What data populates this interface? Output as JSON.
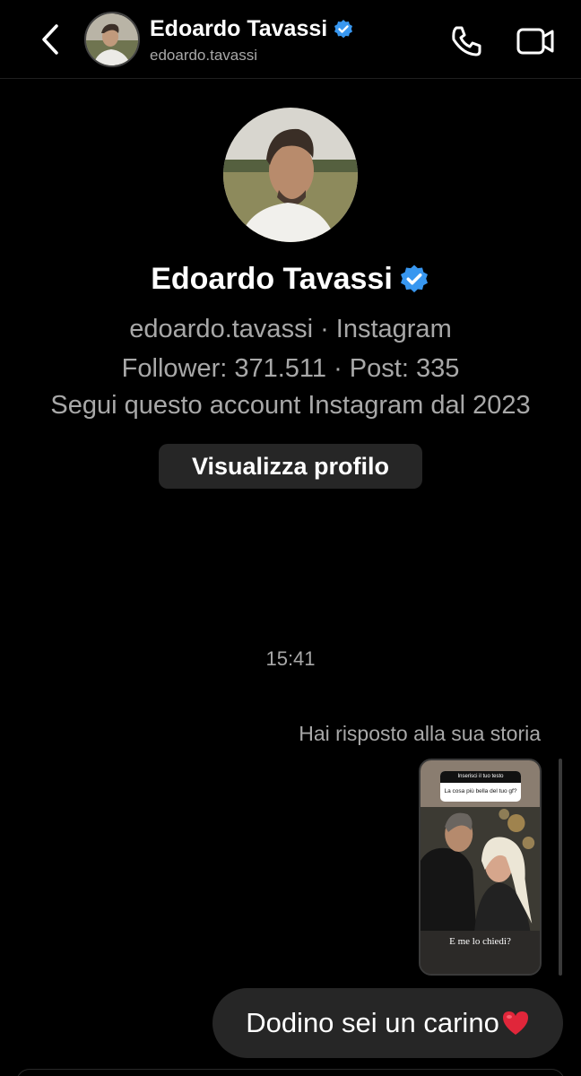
{
  "header": {
    "name": "Edoardo Tavassi",
    "username": "edoardo.tavassi",
    "verified": true
  },
  "profile": {
    "name": "Edoardo Tavassi",
    "meta_line": "edoardo.tavassi · Instagram",
    "stats_line": "Follower: 371.511 · Post: 335",
    "following_since": "Segui questo account Instagram dal 2023",
    "view_profile_label": "Visualizza profilo"
  },
  "conversation": {
    "timestamp": "15:41",
    "story_reply_label": "Hai risposto alla sua storia",
    "story": {
      "question_header": "Inserisci il tuo testo",
      "question": "La cosa più bella del tuo gf?",
      "answer": "E me lo chiedi?"
    },
    "message": {
      "text": "Dodino sei un carino",
      "emoji": "red-heart"
    }
  },
  "colors": {
    "background": "#000000",
    "secondary_text": "#a8a8a8",
    "bubble": "#262626",
    "verified": "#3897f0",
    "heart": "#e0263a"
  },
  "icons": {
    "back": "chevron-left-icon",
    "call": "phone-icon",
    "video": "video-camera-icon",
    "verified": "verified-badge-icon"
  }
}
